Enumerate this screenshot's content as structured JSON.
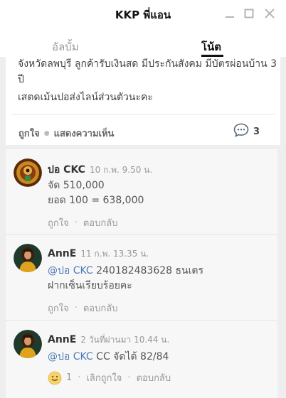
{
  "window": {
    "title": "KKP พี่แอน"
  },
  "tabs": [
    {
      "label": "อัลบั้ม",
      "active": false
    },
    {
      "label": "โน้ต",
      "active": true
    }
  ],
  "post": {
    "text_lines": [
      "จังหวัดลพบุรี ลูกค้ารับเงินสด มีประกันสังคม มีบัตรผ่อนบ้าน 3",
      "ปี",
      "เสตดเม้นปอส่งไลน์ส่วนตัวนะคะ"
    ],
    "like_label": "ถูกใจ",
    "comment_label": "แสดงความเห็น",
    "comment_count": "3"
  },
  "comments": [
    {
      "author": "ปอ CKC",
      "time": "10 ก.พ. 9.50 น.",
      "lines": [
        {
          "mention": "",
          "text": "จัด 510,000"
        },
        {
          "mention": "",
          "text": "ยอด 100 = 638,000"
        }
      ],
      "reaction_count": "",
      "like_label": "ถูกใจ",
      "reply_label": "ตอบกลับ"
    },
    {
      "author": "AnnE",
      "time": "11 ก.พ. 13.35 น.",
      "lines": [
        {
          "mention": "@ปอ CKC",
          "text": " 240182483628 ธนเตร"
        },
        {
          "mention": "",
          "text": "ฝากเซ็นเรียบร้อยคะ"
        }
      ],
      "reaction_count": "",
      "like_label": "ถูกใจ",
      "reply_label": "ตอบกลับ"
    },
    {
      "author": "AnnE",
      "time": "2 วันที่ผ่านมา 10.44 น.",
      "lines": [
        {
          "mention": "@ปอ CKC",
          "text": " CC จัดได้ 82/84"
        }
      ],
      "reaction_count": "1",
      "like_label": "เลิกถูกใจ",
      "reply_label": "ตอบกลับ"
    }
  ],
  "colors": {
    "mention": "#4a7ab5",
    "bubble_icon": "#5a6a7a",
    "emoji": "#f5d26a"
  },
  "icons": {
    "minimize": "minimize-icon",
    "maximize": "maximize-icon",
    "close": "close-icon",
    "comments": "speech-bubble-icon",
    "reaction": "smile-emoji-icon"
  }
}
